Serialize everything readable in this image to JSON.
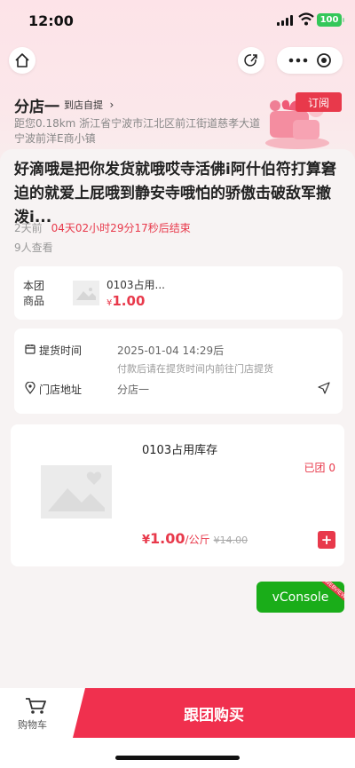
{
  "status_bar": {
    "time": "12:00",
    "battery": "100"
  },
  "store": {
    "name": "分店一",
    "pickup_label": "到店自提",
    "address": "距您0.18km  浙江省宁波市江北区前江街道慈孝大道宁波前洋E商小镇",
    "subscribe_label": "订阅"
  },
  "group": {
    "title": "好滴哦是把你发货就哦哎寺活佛i阿什伯符打算窘迫的就爱上屁哦到静安寺哦怕的骄傲击破敌军撤泼i...",
    "posted": "2天前",
    "countdown": "04天02小时29分17秒后结束",
    "views": "9人查看"
  },
  "group_product": {
    "tag": "本团商品",
    "name": "0103占用...",
    "currency": "¥",
    "price": "1.00"
  },
  "pickup_info": {
    "time_label": "提货时间",
    "time_value": "2025-01-04 14:29后",
    "time_note": "付款后请在提货时间内前往门店提货",
    "addr_label": "门店地址",
    "addr_value": "分店一"
  },
  "product": {
    "name": "0103占用库存",
    "joined": "已团 0",
    "currency": "¥",
    "price": "1.00",
    "unit": "/公斤",
    "original_price": "¥14.00",
    "add_label": "+"
  },
  "vconsole": {
    "label": "vConsole",
    "ribbon": "WEBVIEW"
  },
  "bottom_bar": {
    "cart_label": "购物车",
    "buy_label": "跟团购买"
  },
  "colors": {
    "accent": "#e8394b",
    "buy": "#f0304e",
    "vconsole": "#1aad19"
  }
}
